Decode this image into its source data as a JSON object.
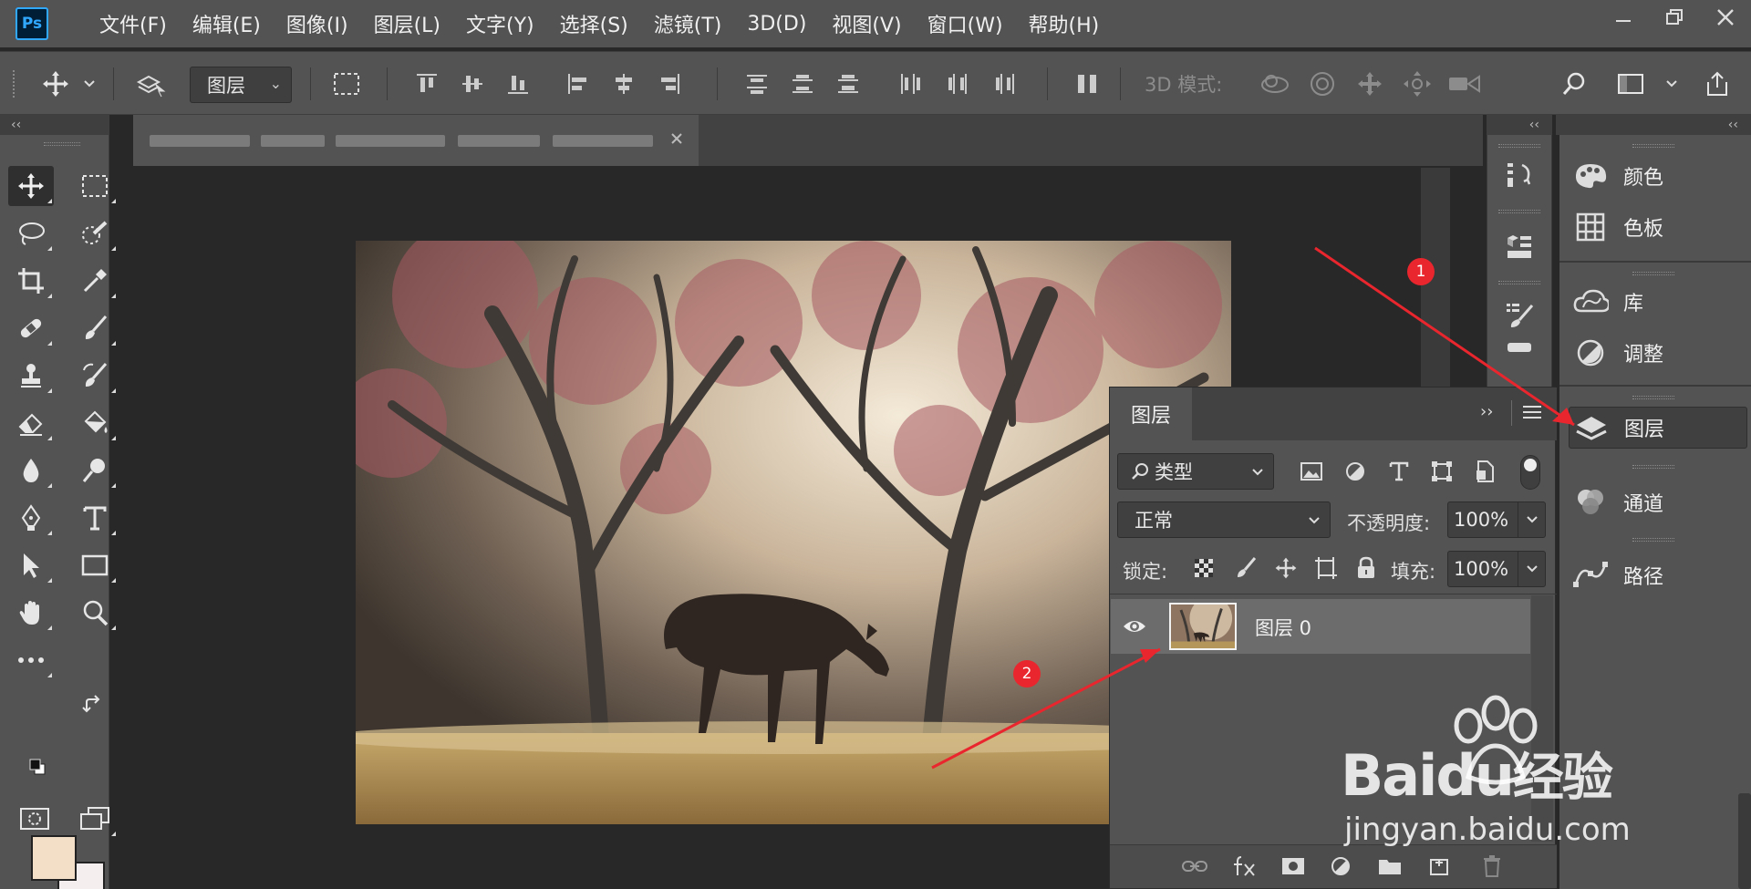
{
  "app": {
    "logo_text": "Ps"
  },
  "menu": [
    "文件(F)",
    "编辑(E)",
    "图像(I)",
    "图层(L)",
    "文字(Y)",
    "选择(S)",
    "滤镜(T)",
    "3D(D)",
    "视图(V)",
    "窗口(W)",
    "帮助(H)"
  ],
  "options_bar": {
    "auto_select_target": "图层",
    "mode_3d_label": "3D 模式:"
  },
  "collapse_glyph": "‹‹",
  "expand_glyph": "››",
  "right_panels": [
    {
      "label": "颜色",
      "icon": "palette-icon"
    },
    {
      "label": "色板",
      "icon": "swatches-grid-icon"
    },
    {
      "label": "库",
      "icon": "cloud-library-icon"
    },
    {
      "label": "调整",
      "icon": "adjustments-icon"
    },
    {
      "label": "图层",
      "icon": "layers-icon"
    },
    {
      "label": "通道",
      "icon": "channels-icon"
    },
    {
      "label": "路径",
      "icon": "paths-icon"
    }
  ],
  "layers_panel": {
    "tab_label": "图层",
    "filter_kind": "类型",
    "blend_mode": "正常",
    "opacity_label": "不透明度:",
    "opacity_value": "100%",
    "lock_label": "锁定:",
    "fill_label": "填充:",
    "fill_value": "100%",
    "layers": [
      {
        "name": "图层 0",
        "visible": true
      }
    ]
  },
  "colors": {
    "foreground": "#f3dfc7",
    "background": "#f4eeee",
    "annotation": "#e9262d",
    "ui_panel": "#535353"
  },
  "annotations": [
    {
      "label": "1"
    },
    {
      "label": "2"
    }
  ],
  "watermark": {
    "brand": "Bai",
    "brand_accent": "du",
    "brand_cn": "经验",
    "url": "jingyan.baidu.com"
  }
}
